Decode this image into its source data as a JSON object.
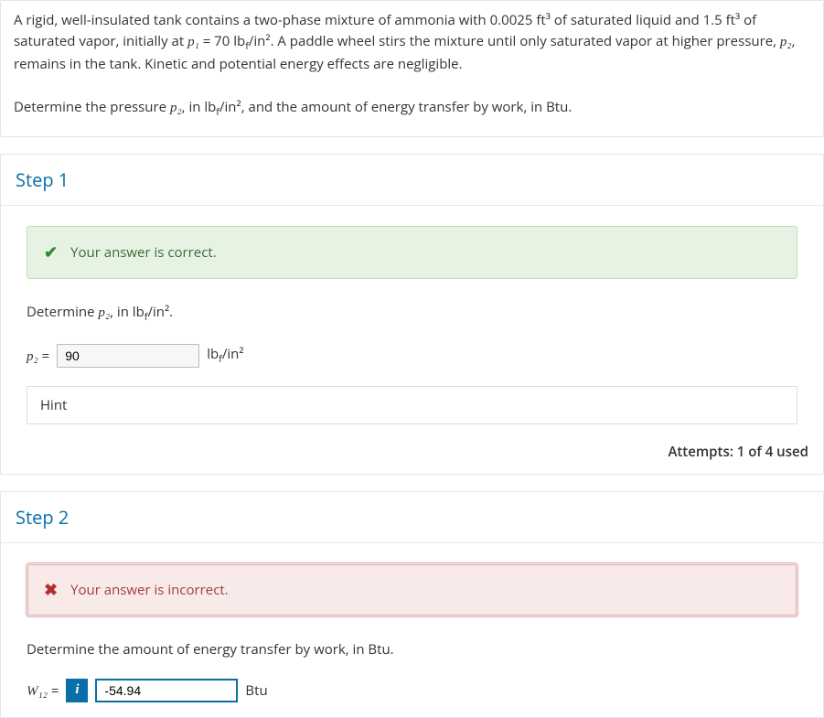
{
  "problem": {
    "p1": "A rigid, well-insulated tank contains a two-phase mixture of ammonia with 0.0025 ft³ of saturated liquid and 1.5 ft³ of saturated vapor, initially at ",
    "p1var": "p₁",
    "p1rest": " = 70 lb",
    "p1sub": "f",
    "p1rest2": "/in².  A paddle wheel stirs the mixture until only saturated vapor at higher pressure, ",
    "p2var": "p₂",
    "p1end": ", remains in the tank. Kinetic and potential energy effects are negligible.",
    "q": "Determine the pressure ",
    "qvar": "p₂",
    "qmid": ", in lb",
    "qsub": "f",
    "qend": "/in², and the amount of energy transfer by work, in Btu."
  },
  "step1": {
    "title": "Step 1",
    "alert": "Your answer is correct.",
    "prompt_a": "Determine ",
    "prompt_var": "p₂",
    "prompt_b": ", in lb",
    "prompt_sub": "f",
    "prompt_c": "/in².",
    "var": "p₂",
    "eq": " = ",
    "value": "90",
    "unit_a": "lb",
    "unit_sub": "f",
    "unit_b": "/in²",
    "hint": "Hint",
    "attempts": "Attempts: 1 of 4 used"
  },
  "step2": {
    "title": "Step 2",
    "alert": "Your answer is incorrect.",
    "prompt": "Determine the amount of energy transfer by work, in Btu.",
    "var": "W₁₂",
    "eq": " = ",
    "value": "-54.94",
    "unit": "Btu",
    "info": "i"
  }
}
